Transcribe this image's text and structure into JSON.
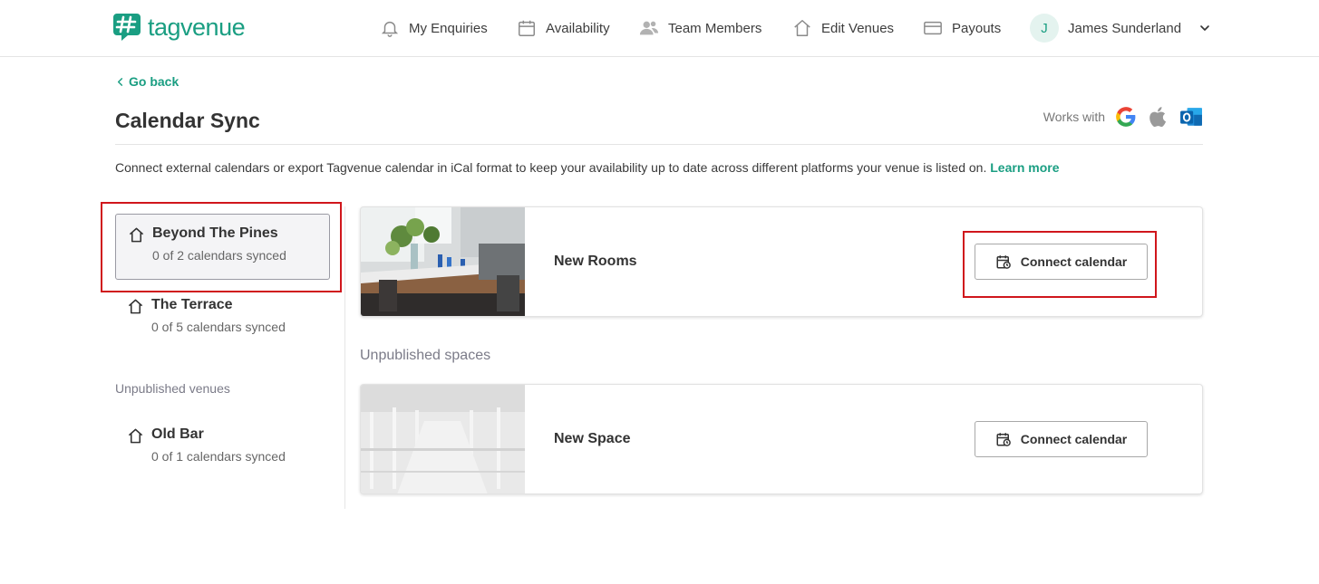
{
  "brand": {
    "name": "tagvenue",
    "color": "#1a9e82"
  },
  "nav": {
    "items": [
      {
        "label": "My Enquiries",
        "icon": "bell-icon"
      },
      {
        "label": "Availability",
        "icon": "calendar-icon"
      },
      {
        "label": "Team Members",
        "icon": "users-icon"
      },
      {
        "label": "Edit Venues",
        "icon": "home-icon"
      },
      {
        "label": "Payouts",
        "icon": "credit-card-icon"
      }
    ],
    "user": {
      "initial": "J",
      "name": "James Sunderland"
    }
  },
  "page": {
    "back_label": "Go back",
    "title": "Calendar Sync",
    "works_with_label": "Works with",
    "works_with_icons": [
      "google-icon",
      "apple-icon",
      "outlook-icon"
    ],
    "intro_text": "Connect external calendars or export Tagvenue calendar in iCal format to keep your availability up to date across different platforms your venue is listed on.",
    "learn_more": "Learn more"
  },
  "venues": {
    "published": [
      {
        "name": "Beyond The Pines",
        "status": "0 of 2 calendars synced",
        "active": true
      },
      {
        "name": "The Terrace",
        "status": "0 of 5 calendars synced",
        "active": false
      }
    ],
    "unpublished_label": "Unpublished venues",
    "unpublished": [
      {
        "name": "Old Bar",
        "status": "0 of 1 calendars synced"
      }
    ]
  },
  "spaces": {
    "published": [
      {
        "name": "New Rooms",
        "button": "Connect calendar"
      }
    ],
    "unpublished_label": "Unpublished spaces",
    "unpublished": [
      {
        "name": "New Space",
        "button": "Connect calendar"
      }
    ]
  },
  "colors": {
    "accent": "#1a9e82",
    "highlight": "#d0161c"
  }
}
